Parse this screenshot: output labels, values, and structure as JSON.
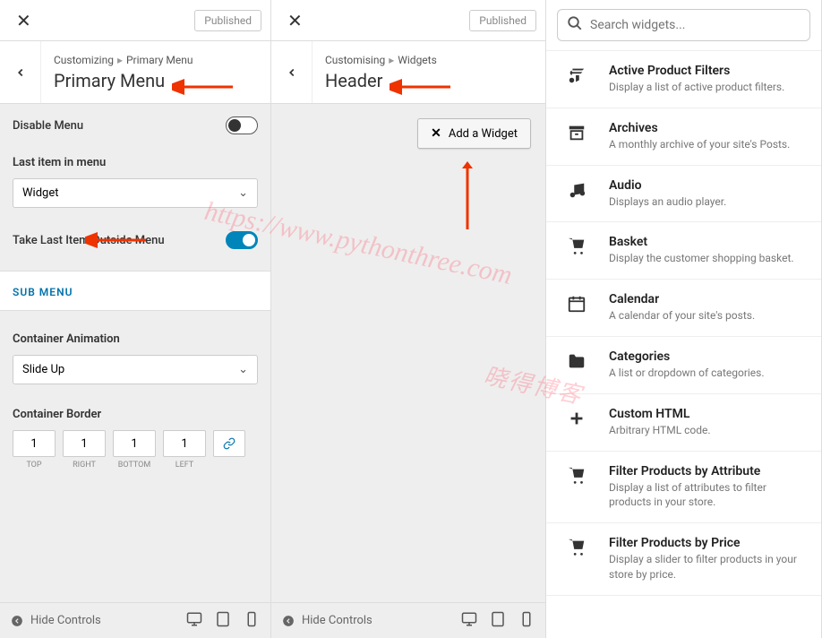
{
  "panels": {
    "left": {
      "published": "Published",
      "breadcrumb": [
        "Customizing",
        "Primary Menu"
      ],
      "title": "Primary Menu",
      "disable_menu_label": "Disable Menu",
      "disable_menu_on": false,
      "last_item_label": "Last item in menu",
      "last_item_value": "Widget",
      "take_outside_label": "Take Last Item Outside Menu",
      "take_outside_on": true,
      "sub_menu": "SUB MENU",
      "container_animation_label": "Container Animation",
      "container_animation_value": "Slide Up",
      "container_border_label": "Container Border",
      "border_values": [
        "1",
        "1",
        "1",
        "1"
      ],
      "border_labels": [
        "TOP",
        "RIGHT",
        "BOTTOM",
        "LEFT"
      ]
    },
    "middle": {
      "published": "Published",
      "breadcrumb": [
        "Customising",
        "Widgets"
      ],
      "title": "Header",
      "add_widget": "Add a Widget"
    },
    "right": {
      "search_placeholder": "Search widgets...",
      "widgets": [
        {
          "icon": "filter",
          "title": "Active Product Filters",
          "desc": "Display a list of active product filters."
        },
        {
          "icon": "archive",
          "title": "Archives",
          "desc": "A monthly archive of your site's Posts."
        },
        {
          "icon": "audio",
          "title": "Audio",
          "desc": "Displays an audio player."
        },
        {
          "icon": "cart",
          "title": "Basket",
          "desc": "Display the customer shopping basket."
        },
        {
          "icon": "calendar",
          "title": "Calendar",
          "desc": "A calendar of your site's posts."
        },
        {
          "icon": "folder",
          "title": "Categories",
          "desc": "A list or dropdown of categories."
        },
        {
          "icon": "plus",
          "title": "Custom HTML",
          "desc": "Arbitrary HTML code."
        },
        {
          "icon": "cart",
          "title": "Filter Products by Attribute",
          "desc": "Display a list of attributes to filter products in your store."
        },
        {
          "icon": "cart",
          "title": "Filter Products by Price",
          "desc": "Display a slider to filter products in your store by price."
        }
      ]
    },
    "bottom": {
      "hide_controls": "Hide Controls"
    }
  },
  "watermark1": "https://www.pythonthree.com",
  "watermark2": "晓得博客"
}
